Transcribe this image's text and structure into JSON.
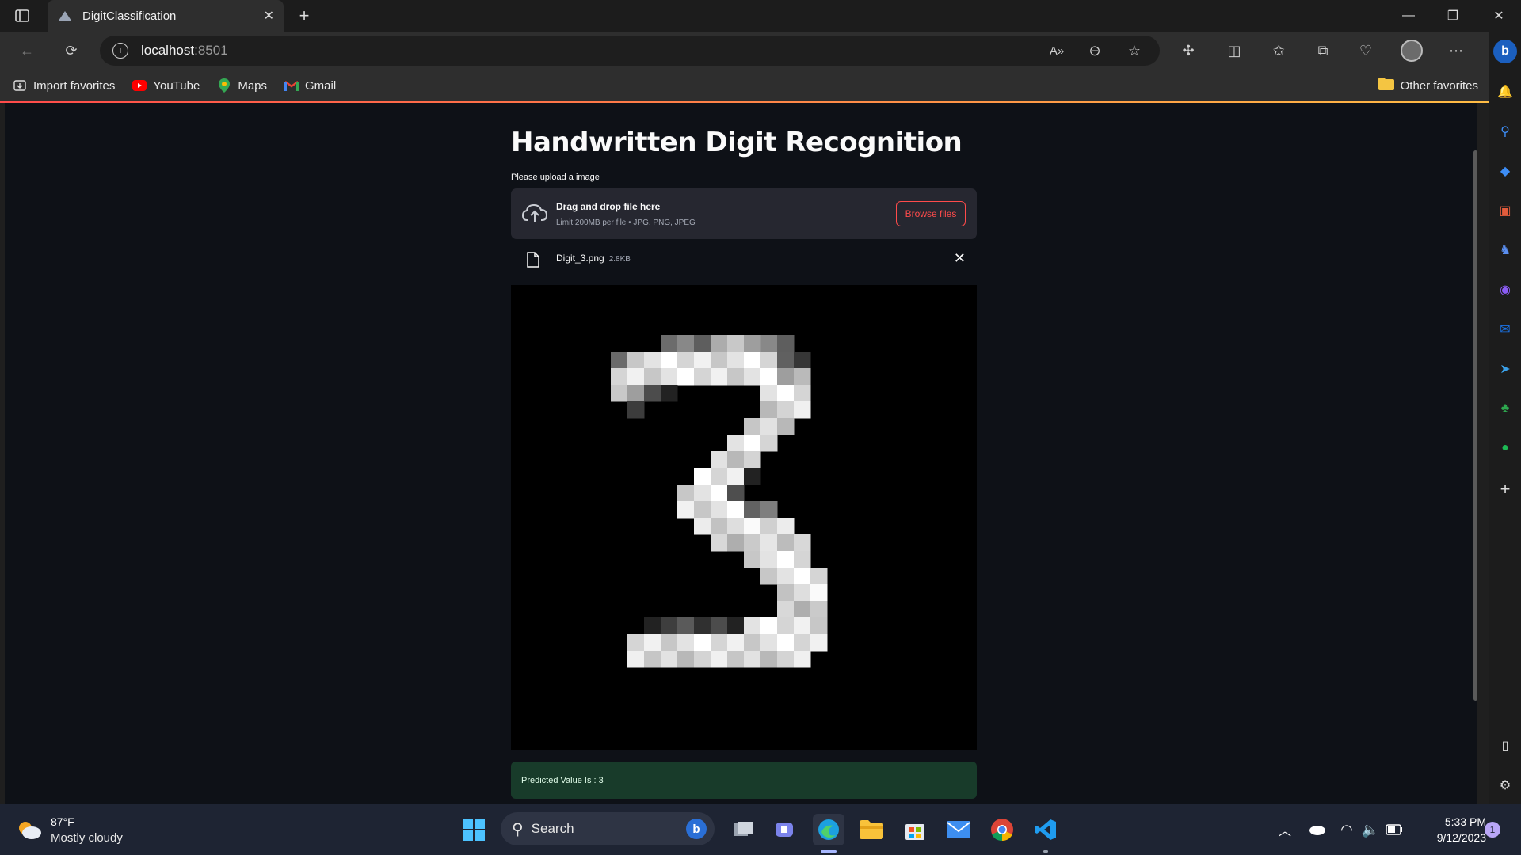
{
  "browser": {
    "tab_title": "DigitClassification",
    "address_host": "localhost",
    "address_port": ":8501",
    "bookmarks": [
      "Import favorites",
      "YouTube",
      "Maps",
      "Gmail"
    ],
    "other_favorites": "Other favorites"
  },
  "app": {
    "title": "Handwritten Digit Recognition",
    "upload_label": "Please upload a image",
    "dropzone_main": "Drag and drop file here",
    "dropzone_sub": "Limit 200MB per file • JPG, PNG, JPEG",
    "browse_button": "Browse files",
    "file_name": "Digit_3.png",
    "file_size": "2.8KB",
    "result_text": "Predicted Value Is : 3"
  },
  "taskbar": {
    "temperature": "87°F",
    "weather": "Mostly cloudy",
    "search": "Search",
    "time": "5:33 PM",
    "date": "9/12/2023",
    "notification_count": "1"
  },
  "colors": {
    "accent": "#ff4b4b",
    "page_bg": "#0e1117",
    "success_bg": "#183b2a"
  }
}
